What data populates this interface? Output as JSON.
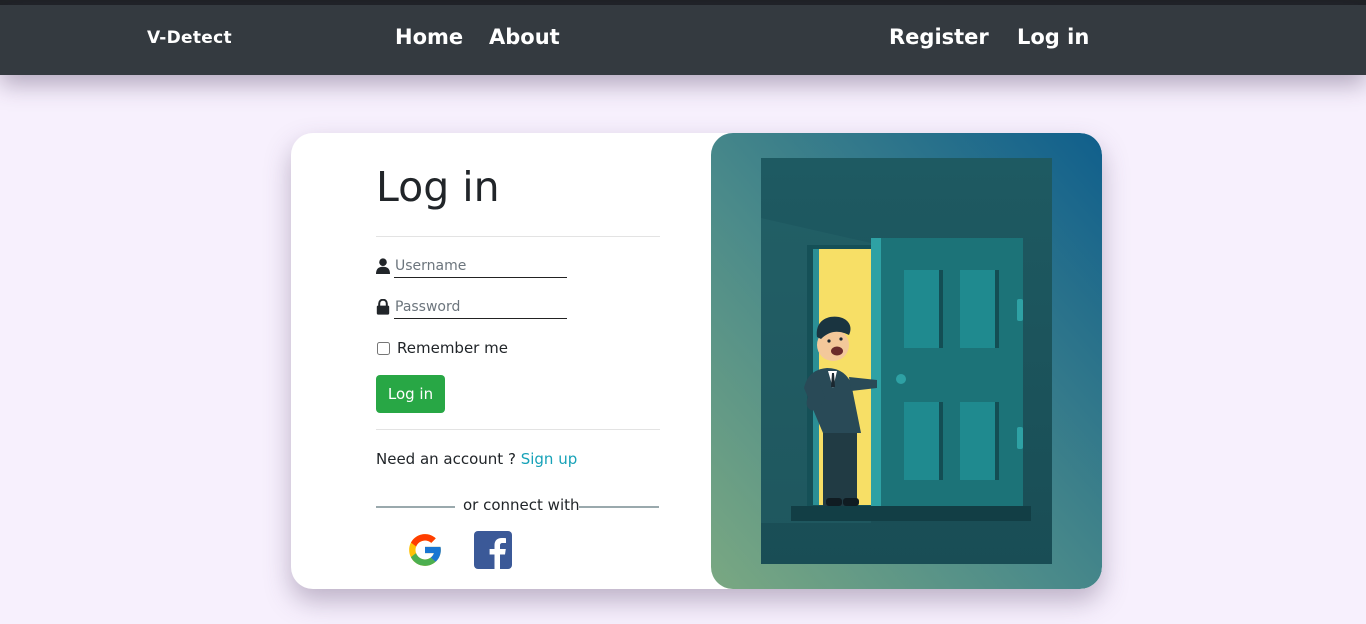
{
  "navbar": {
    "brand": "V-Detect",
    "links": {
      "home": "Home",
      "about": "About",
      "register": "Register",
      "login": "Log in"
    }
  },
  "login_form": {
    "title": "Log in",
    "username_placeholder": "Username",
    "password_placeholder": "Password",
    "remember_label": "Remember me",
    "submit_label": "Log in",
    "need_account_text": "Need an account ?",
    "signup_link": "Sign up",
    "connect_text": "or connect with",
    "social": [
      "google-icon",
      "facebook-icon"
    ]
  },
  "colors": {
    "navbar_bg": "#343a40",
    "page_bg": "#f7f0fd",
    "button_green": "#28a745",
    "link_teal": "#17a2b8",
    "facebook_blue": "#3b5998"
  }
}
